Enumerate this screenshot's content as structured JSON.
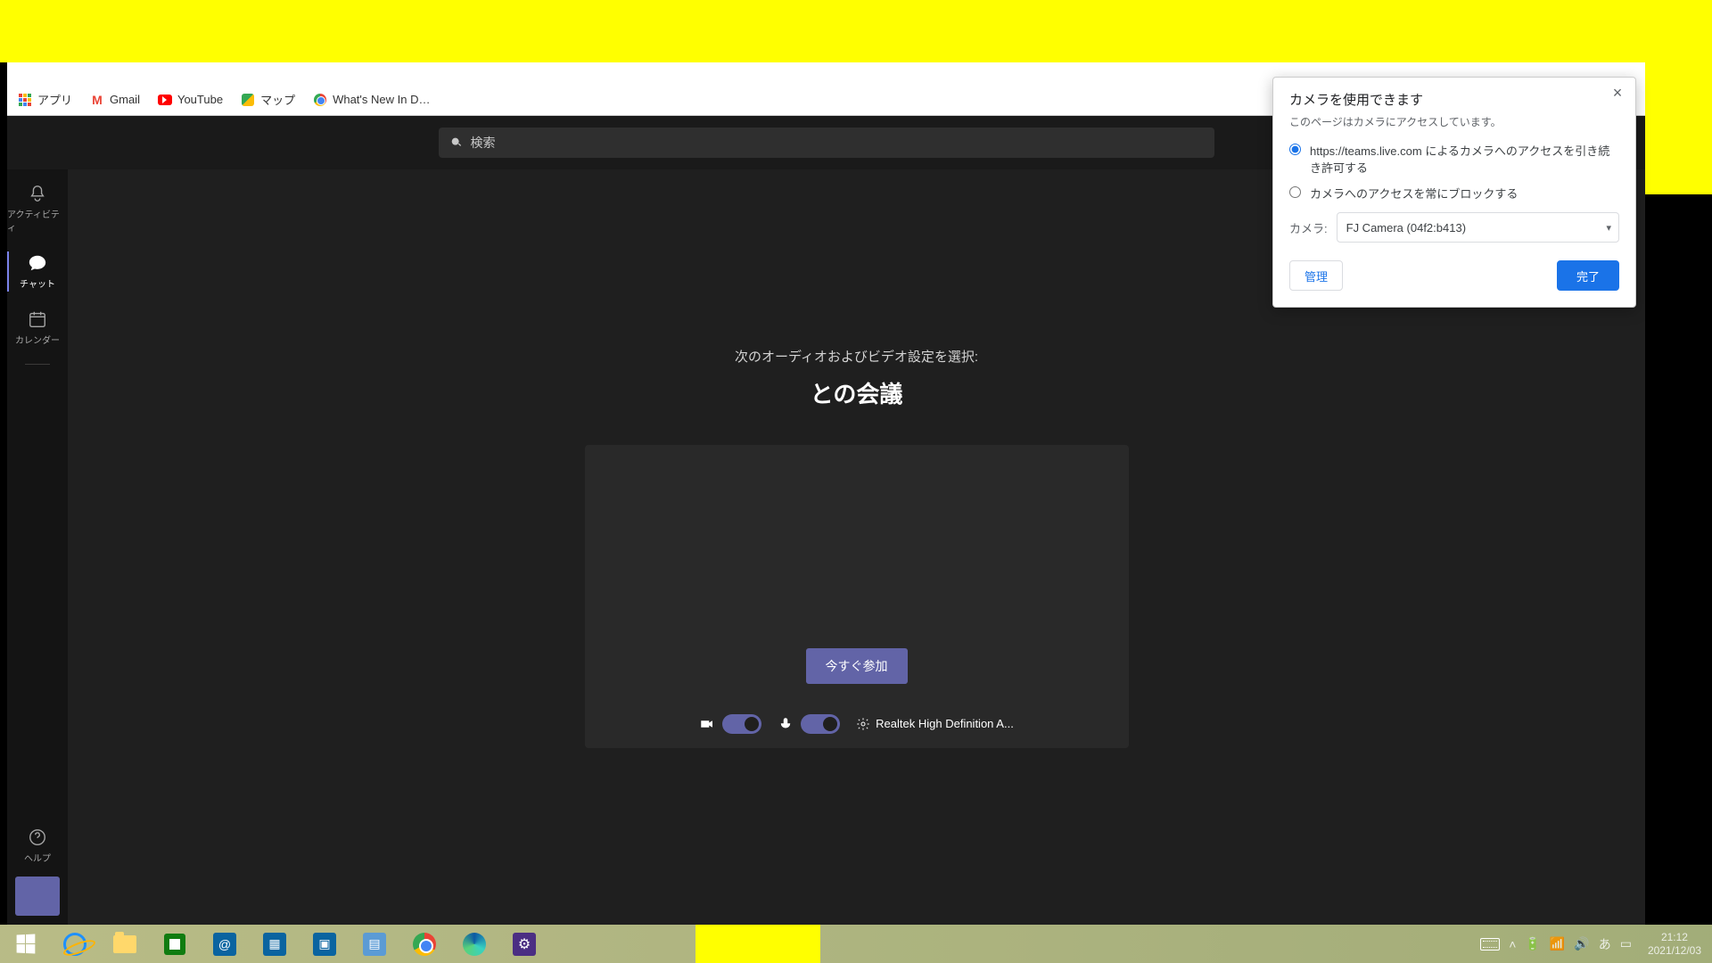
{
  "bookmarks": {
    "apps": "アプリ",
    "gmail": "Gmail",
    "youtube": "YouTube",
    "maps": "マップ",
    "whatsnew": "What's New In D…"
  },
  "permission_popup": {
    "title": "カメラを使用できます",
    "subtitle": "このページはカメラにアクセスしています。",
    "option_allow": "https://teams.live.com によるカメラへのアクセスを引き続き許可する",
    "option_block": "カメラへのアクセスを常にブロックする",
    "camera_label": "カメラ:",
    "camera_value": "FJ Camera (04f2:b413)",
    "manage": "管理",
    "done": "完了"
  },
  "teams": {
    "search_placeholder": "検索",
    "close_button": "閉じる",
    "rail": {
      "activity": "アクティビティ",
      "chat": "チャット",
      "calendar": "カレンダー",
      "help": "ヘルプ"
    },
    "meeting": {
      "pretext": "次のオーディオおよびビデオ設定を選択:",
      "title": "との会議",
      "join": "今すぐ参加",
      "audio_device": "Realtek High Definition A..."
    }
  },
  "taskbar": {
    "time": "21:12",
    "date": "2021/12/03",
    "ime": "あ"
  }
}
